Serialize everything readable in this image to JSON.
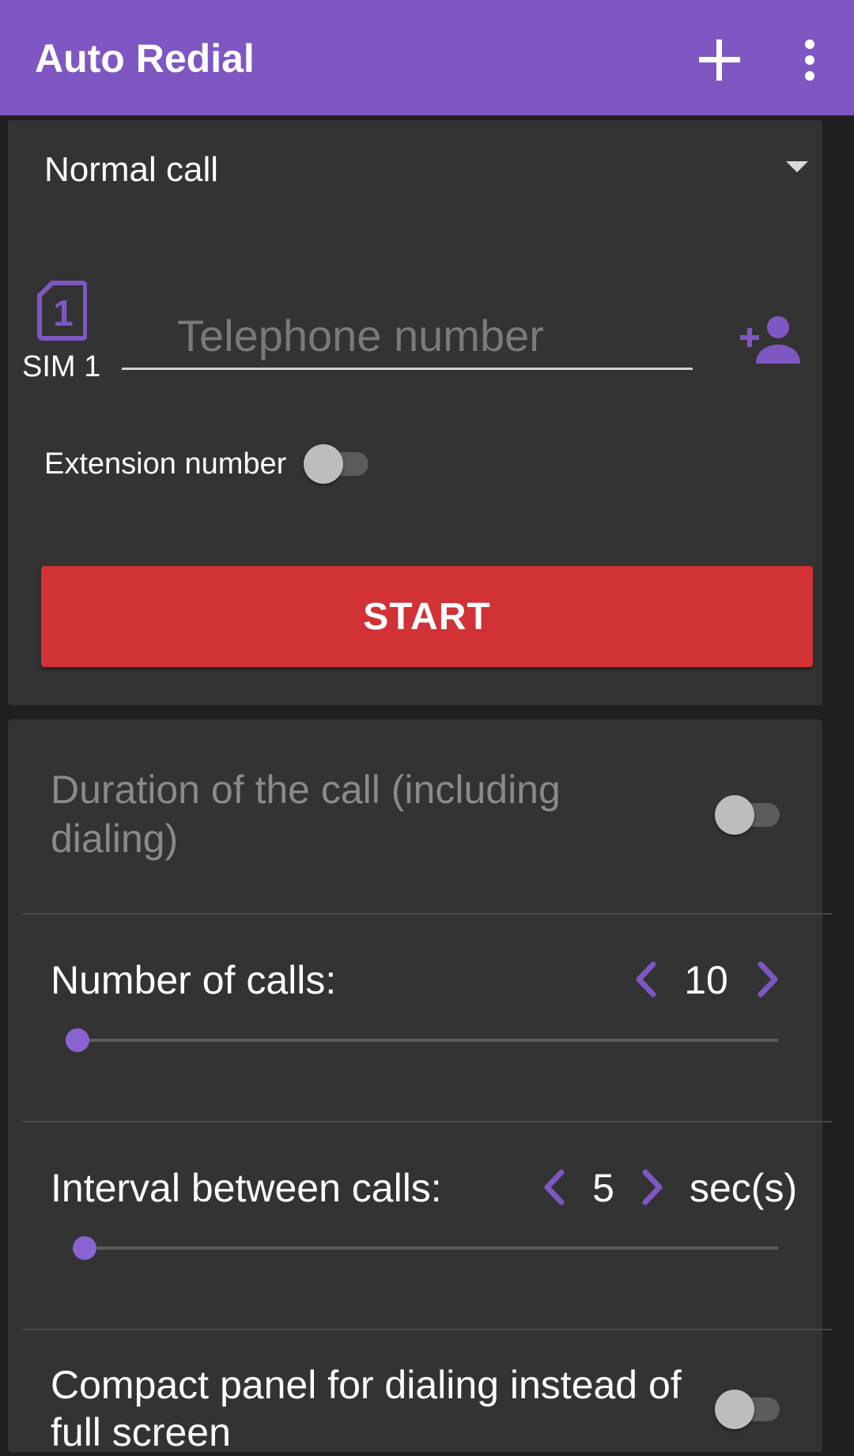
{
  "app": {
    "title": "Auto Redial",
    "actions": {
      "add_icon": "plus-icon",
      "menu_icon": "more-vertical-icon"
    },
    "accent_color": "#7e57c2"
  },
  "call_setup": {
    "call_type": {
      "selected": "Normal call"
    },
    "sim": {
      "label": "SIM 1",
      "icon": "sim-card-1-icon"
    },
    "phone_number": {
      "value": "",
      "placeholder": "Telephone number"
    },
    "add_contact_icon": "person-add-icon",
    "extension": {
      "label": "Extension number",
      "enabled": false
    },
    "start_button": {
      "label": "START",
      "color": "#d03236"
    }
  },
  "settings": {
    "call_duration": {
      "label": "Duration of the call (including dialing)",
      "enabled": false
    },
    "number_of_calls": {
      "label": "Number of calls:",
      "value": "10",
      "slider_fraction": 0.0
    },
    "interval": {
      "label": "Interval between calls:",
      "value": "5",
      "unit": "sec(s)",
      "slider_fraction": 0.01
    },
    "compact_panel": {
      "label": "Compact panel for dialing instead of full screen",
      "enabled": false
    }
  }
}
